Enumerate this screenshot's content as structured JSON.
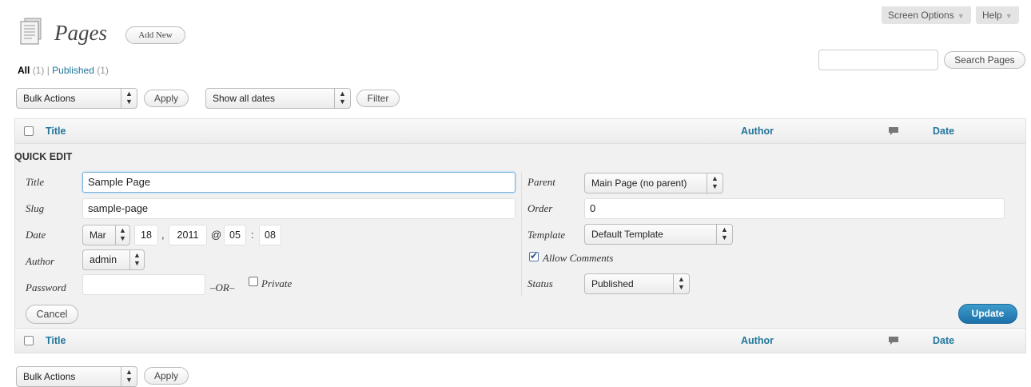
{
  "header": {
    "screen_options_label": "Screen Options",
    "help_label": "Help",
    "page_title": "Pages",
    "add_new_label": "Add New"
  },
  "views": {
    "all_label": "All",
    "all_count": "(1)",
    "separator": "|",
    "published_label": "Published",
    "published_count": "(1)"
  },
  "search": {
    "value": "",
    "button_label": "Search Pages"
  },
  "tablenav_top": {
    "bulk_actions": "Bulk Actions",
    "apply_label": "Apply",
    "date_filter": "Show all dates",
    "filter_label": "Filter"
  },
  "table": {
    "columns": {
      "title": "Title",
      "author": "Author",
      "date": "Date",
      "comments_icon": "comment-bubble-icon"
    }
  },
  "quick_edit": {
    "heading": "QUICK EDIT",
    "title_label": "Title",
    "title_value": "Sample Page",
    "slug_label": "Slug",
    "slug_value": "sample-page",
    "date_label": "Date",
    "date_month": "Mar",
    "date_day": "18",
    "date_comma": ",",
    "date_year": "2011",
    "date_at": "@",
    "date_hour": "05",
    "date_colon": ":",
    "date_minute": "08",
    "author_label": "Author",
    "author_value": "admin",
    "password_label": "Password",
    "password_value": "",
    "or_label": "–OR–",
    "private_label": "Private",
    "private_checked": false,
    "parent_label": "Parent",
    "parent_value": "Main Page (no parent)",
    "order_label": "Order",
    "order_value": "0",
    "template_label": "Template",
    "template_value": "Default Template",
    "allow_comments_label": "Allow Comments",
    "allow_comments_checked": true,
    "status_label": "Status",
    "status_value": "Published",
    "cancel_label": "Cancel",
    "update_label": "Update"
  },
  "tablenav_bottom": {
    "bulk_actions": "Bulk Actions",
    "apply_label": "Apply"
  },
  "colors": {
    "link": "#21759b",
    "primary_button": "#2583c0",
    "panel_bg": "#f1f1f1"
  }
}
